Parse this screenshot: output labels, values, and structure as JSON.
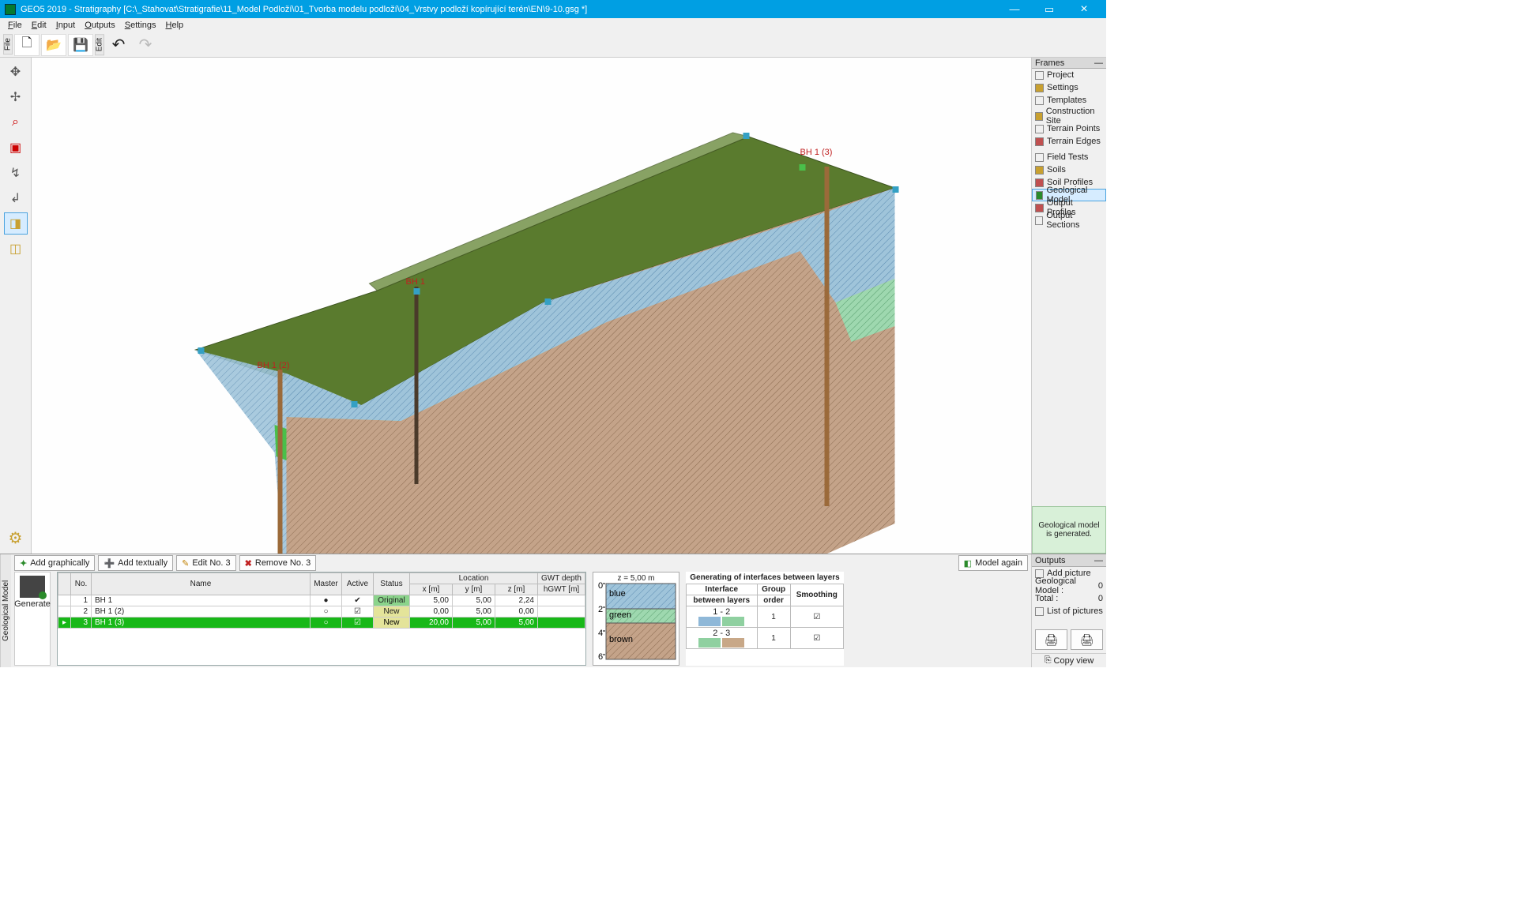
{
  "title": "GEO5 2019 - Stratigraphy [C:\\_Stahovat\\Stratigrafie\\11_Model Podloží\\01_Tvorba modelu podloží\\04_Vrstvy podloží kopírující terén\\EN\\9-10.gsg *]",
  "menu": {
    "file": "File",
    "edit": "Edit",
    "input": "Input",
    "outputs": "Outputs",
    "settings": "Settings",
    "help": "Help"
  },
  "left_vtab": "File",
  "right_vtab": "Edit",
  "frames": {
    "title": "Frames",
    "items": [
      "Project",
      "Settings",
      "Templates",
      "Construction Site",
      "Terrain Points",
      "Terrain Edges",
      "Field Tests",
      "Soils",
      "Soil Profiles",
      "Geological Model",
      "Output Profiles",
      "Output Sections"
    ],
    "selected": "Geological Model",
    "status": "Geological model is generated."
  },
  "viewport": {
    "labels": {
      "bh1": "BH 1",
      "bh12": "BH 1 (2)",
      "bh13": "BH 1 (3)"
    }
  },
  "bottom": {
    "tab": "Geological Model",
    "btn_add_g": "Add graphically",
    "btn_add_t": "Add textually",
    "btn_edit": "Edit No. 3",
    "btn_remove": "Remove No. 3",
    "btn_model": "Model again",
    "btn_generate": "Generate",
    "headers": {
      "no": "No.",
      "name": "Name",
      "master": "Master",
      "active": "Active",
      "status": "Status",
      "location": "Location",
      "x": "x [m]",
      "y": "y [m]",
      "z": "z [m]",
      "gwt": "GWT depth",
      "hg": "hGWT [m]"
    },
    "rows": [
      {
        "no": "1",
        "name": "BH 1",
        "master": "●",
        "active": "✔",
        "status": "Original",
        "x": "5,00",
        "y": "5,00",
        "z": "2,24",
        "gwt": ""
      },
      {
        "no": "2",
        "name": "BH 1 (2)",
        "master": "○",
        "active": "☑",
        "status": "New",
        "x": "0,00",
        "y": "5,00",
        "z": "0,00",
        "gwt": ""
      },
      {
        "no": "3",
        "name": "BH 1 (3)",
        "master": "○",
        "active": "☑",
        "status": "New",
        "x": "20,00",
        "y": "5,00",
        "z": "5,00",
        "gwt": ""
      }
    ],
    "soil": {
      "z": "z = 5,00 m",
      "ticks": [
        "0",
        "2",
        "4",
        "6"
      ],
      "layers": [
        "blue",
        "green",
        "brown"
      ]
    },
    "interf": {
      "title": "Generating of interfaces between layers",
      "h1": "Interface",
      "h1b": "between layers",
      "h2": "Group",
      "h2b": "order",
      "h3": "Smoothing",
      "rows": [
        {
          "lab": "1 - 2",
          "c1": "#8fb8d8",
          "c2": "#8fd0a0",
          "ord": "1",
          "sm": true
        },
        {
          "lab": "2 - 3",
          "c1": "#8fd0a0",
          "c2": "#c8a888",
          "ord": "1",
          "sm": true
        }
      ]
    }
  },
  "outputs": {
    "title": "Outputs",
    "add_pic": "Add picture",
    "gm": "Geological Model :",
    "gm_v": "0",
    "total": "Total :",
    "total_v": "0",
    "list": "List of pictures",
    "copy": "Copy view"
  }
}
